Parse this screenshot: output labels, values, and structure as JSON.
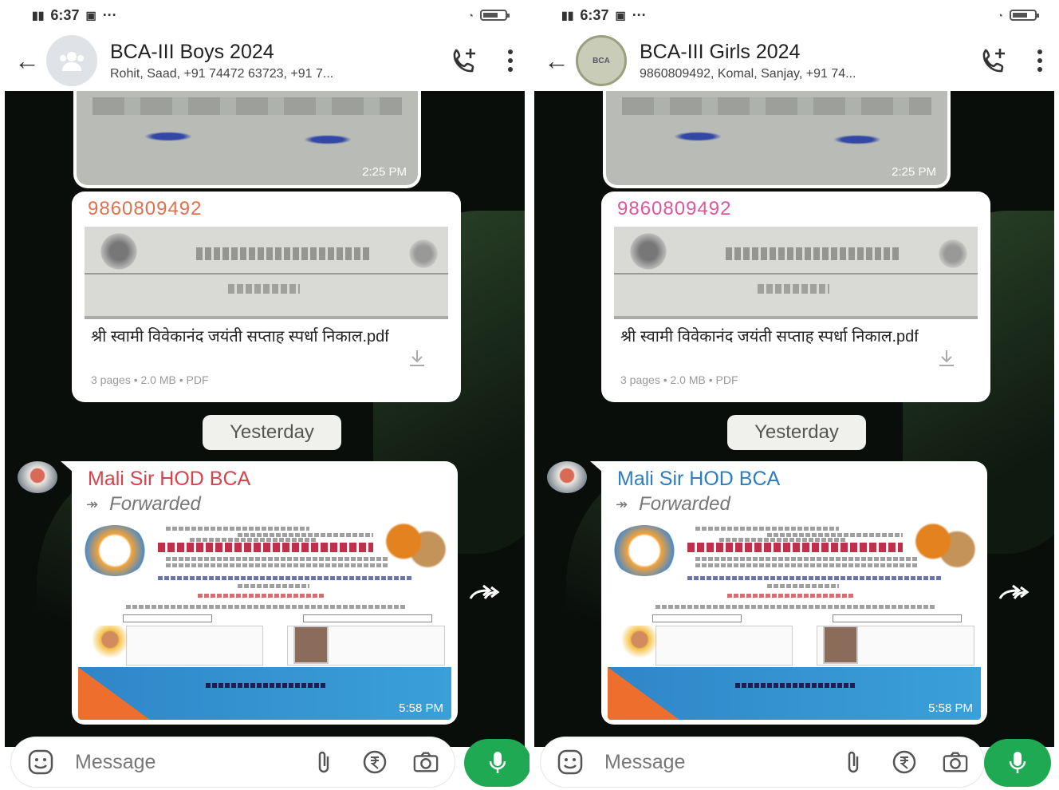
{
  "colors": {
    "sender_num_left": "#e0704e",
    "sender_num_right": "#e0569a",
    "sender_name_left": "#d9424b",
    "sender_name_right": "#2c7ec2",
    "mic_green": "#1ea952",
    "chat_bg": "#0a0e0b"
  },
  "screens": [
    {
      "status": {
        "time": "6:37",
        "dots": "···"
      },
      "header": {
        "title": "BCA-III Boys 2024",
        "subtitle": "Rohit, Saad, +91 74472 63723, +91 7...",
        "avatar": "group-icon"
      },
      "messages": {
        "top_image_time": "2:25 PM",
        "doc_sender": "9860809492",
        "doc_name": "श्री स्वामी विवेकानंद जयंती सप्ताह स्पर्धा निकाल.pdf",
        "doc_meta": "3 pages • 2.0 MB • PDF",
        "date_chip": "Yesterday",
        "fwd_sender": "Mali Sir HOD BCA",
        "fwd_label": "Forwarded",
        "fwd_time": "5:58 PM"
      },
      "input": {
        "placeholder": "Message"
      }
    },
    {
      "status": {
        "time": "6:37",
        "dots": "···"
      },
      "header": {
        "title": "BCA-III Girls 2024",
        "subtitle": "9860809492, Komal, Sanjay, +91 74...",
        "avatar": "group-logo",
        "avatar_text": "BCA"
      },
      "messages": {
        "top_image_time": "2:25 PM",
        "doc_sender": "9860809492",
        "doc_name": "श्री स्वामी विवेकानंद जयंती सप्ताह स्पर्धा निकाल.pdf",
        "doc_meta": "3 pages • 2.0 MB • PDF",
        "date_chip": "Yesterday",
        "fwd_sender": "Mali Sir HOD BCA",
        "fwd_label": "Forwarded",
        "fwd_time": "5:58 PM"
      },
      "input": {
        "placeholder": "Message"
      }
    }
  ]
}
